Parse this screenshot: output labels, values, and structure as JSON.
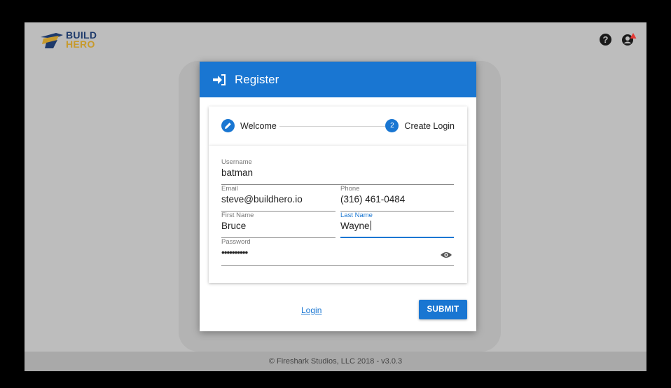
{
  "brand": {
    "line1": "BUILD",
    "line2": "HERO"
  },
  "topbar": {
    "help_glyph": "?"
  },
  "dialog": {
    "title": "Register",
    "steps": [
      {
        "label": "Welcome",
        "state": "edit"
      },
      {
        "number": "2",
        "label": "Create Login",
        "state": "active"
      }
    ],
    "fields": {
      "username": {
        "label": "Username",
        "value": "batman"
      },
      "email": {
        "label": "Email",
        "value": "steve@buildhero.io"
      },
      "phone": {
        "label": "Phone",
        "value": "(316) 461-0484"
      },
      "first_name": {
        "label": "First Name",
        "value": "Bruce"
      },
      "last_name": {
        "label": "Last Name",
        "value": "Wayne"
      },
      "password": {
        "label": "Password",
        "value": "••••••••••"
      }
    },
    "login_label": "Login",
    "submit_label": "SUBMIT"
  },
  "footer": {
    "text": "© Fireshark Studios, LLC 2018 - v3.0.3"
  },
  "colors": {
    "primary": "#1976d2",
    "brand_navy": "#1e3a6b",
    "brand_gold": "#c79a2c",
    "backdrop": "#bdbdbd"
  },
  "icons": [
    "build-hero-logo-icon",
    "help-icon",
    "account-alert-icon",
    "login-icon",
    "pencil-icon",
    "eye-icon"
  ]
}
